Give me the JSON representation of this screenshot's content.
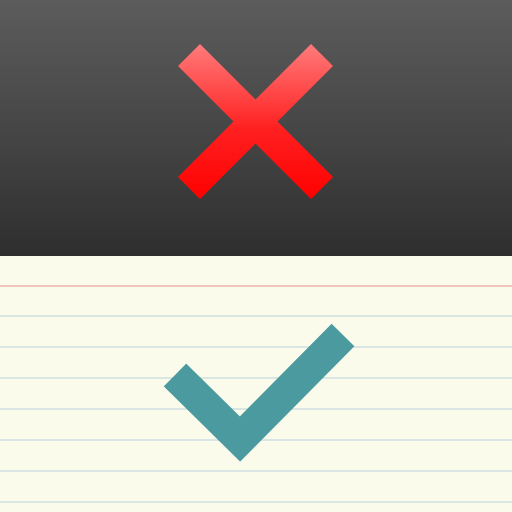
{
  "icon": {
    "top_panel": {
      "symbol": "cross-icon",
      "background_colors": [
        "#5c5c5c",
        "#444444",
        "#2e2e2e"
      ],
      "symbol_colors": [
        "#ff7b7b",
        "#ff0000"
      ]
    },
    "bottom_panel": {
      "symbol": "checkmark-icon",
      "paper_color": "#fbfbeb",
      "margin_line_color": "#f0b8b0",
      "ruled_line_color": "#d5e4e2",
      "symbol_color": "#4a9aa0"
    }
  }
}
